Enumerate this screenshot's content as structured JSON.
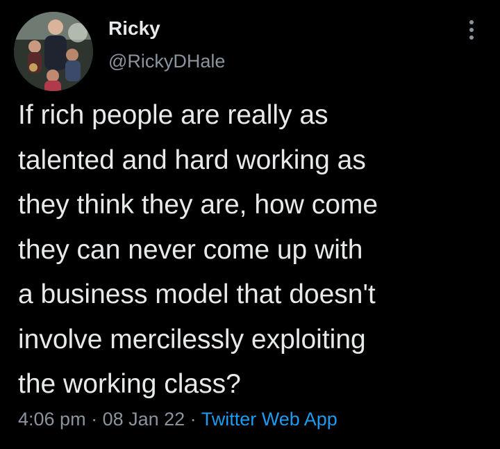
{
  "user": {
    "display_name": "Ricky",
    "handle": "@RickyDHale",
    "avatar": "family-photo-avatar"
  },
  "tweet": {
    "lines": [
      "If rich people are really as",
      "talented and hard working as",
      "they think they are, how come",
      "they can never come up with",
      "a business model that doesn't",
      "involve mercilessly exploiting",
      "the working class?"
    ]
  },
  "meta": {
    "time": "4:06 pm",
    "separator": " · ",
    "date": "08 Jan 22",
    "source": "Twitter Web App"
  },
  "icons": {
    "more": "more-vertical-icon"
  },
  "colors": {
    "background": "#000000",
    "text": "#e7e9ea",
    "secondary": "#8b949e",
    "link": "#1d9bf0"
  }
}
